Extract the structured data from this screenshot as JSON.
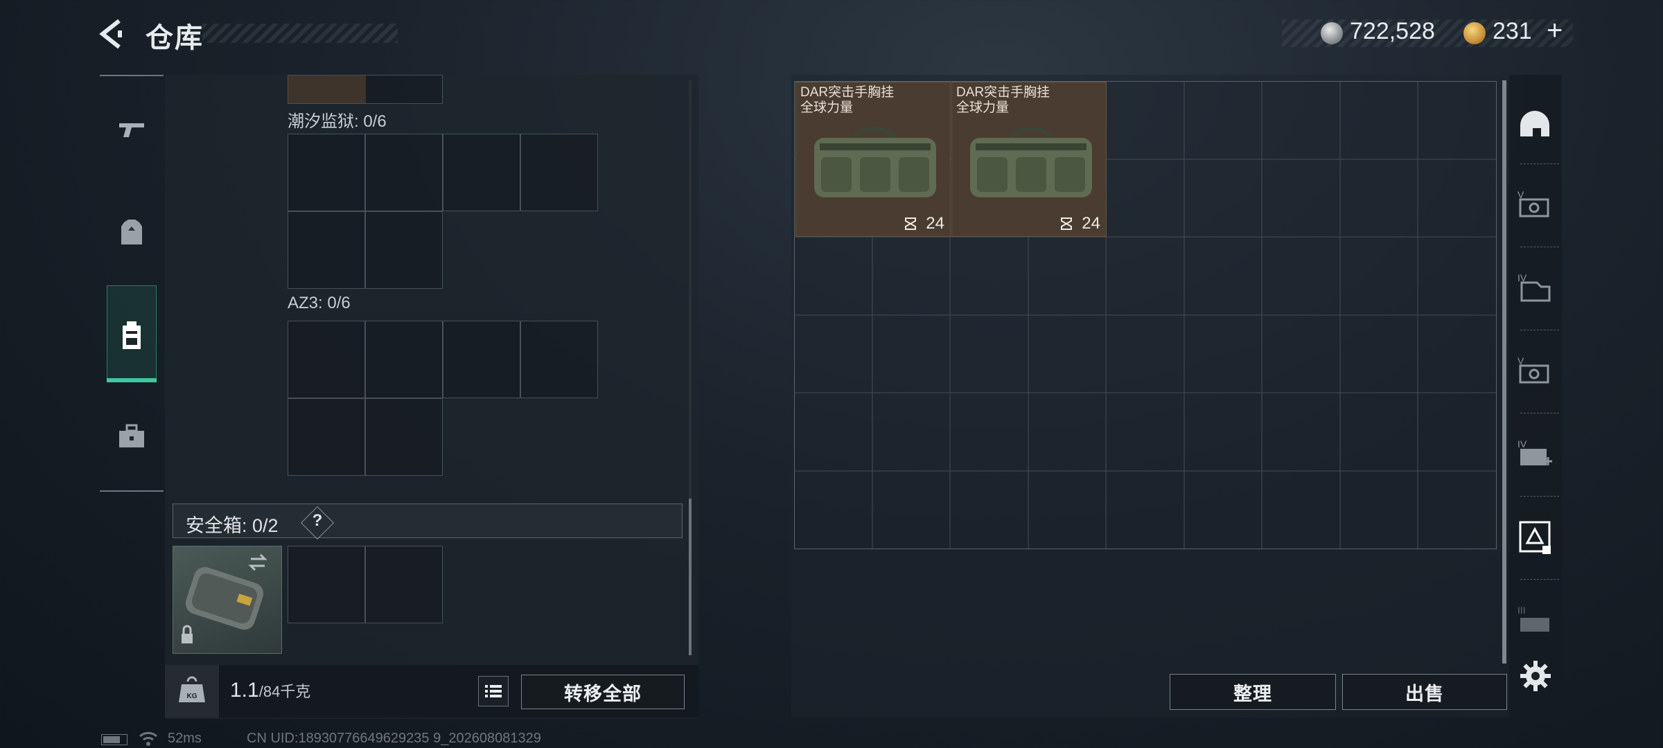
{
  "header": {
    "title": "仓库",
    "currency_silver": "722,528",
    "currency_gold": "231",
    "plus": "+"
  },
  "left_rail": {
    "items": [
      {
        "name": "weapons",
        "icon": "pistol-icon"
      },
      {
        "name": "armor",
        "icon": "vest-icon"
      },
      {
        "name": "backpack",
        "icon": "backpack-icon",
        "active": true
      },
      {
        "name": "case",
        "icon": "briefcase-icon"
      }
    ]
  },
  "left_panel": {
    "slots": [
      {
        "label": "潮汐监狱: 0/6"
      },
      {
        "label": "AZ3: 0/6"
      }
    ],
    "safebox": {
      "label": "安全箱:",
      "count": "0/2",
      "help": "?"
    },
    "weight": {
      "current": "1.1",
      "max": "/84千克"
    },
    "transfer_all": "转移全部"
  },
  "stash": {
    "items": [
      {
        "name_line1": "DAR突击手胸挂",
        "name_line2": "全球力量",
        "count": "24"
      },
      {
        "name_line1": "DAR突击手胸挂",
        "name_line2": "全球力量",
        "count": "24"
      }
    ],
    "sort_label": "整理",
    "sell_label": "出售"
  },
  "right_rail": {
    "icons": [
      "helmet-icon",
      "tier-v-vest-icon",
      "tier-iv-armor-icon",
      "tier-v-rig-icon",
      "tier-iv-medkit-icon",
      "container-icon",
      "tier-iii-bag-icon",
      "gear-icon"
    ]
  },
  "status_bar": {
    "ping": "52ms",
    "uid": "CN UID:18930776649629235 9_202608081329"
  },
  "colors": {
    "accent": "#3fc7a0",
    "item_bg": "#4a3c30"
  }
}
